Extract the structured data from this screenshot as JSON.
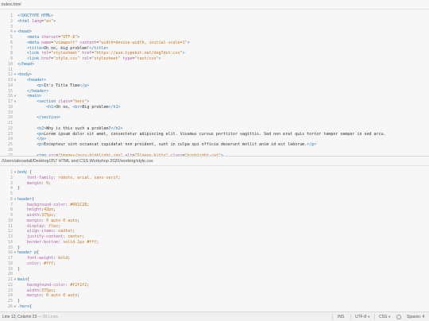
{
  "top_pane": {
    "title": "index.html",
    "lines": [
      {
        "n": "1",
        "fold": "",
        "spans": [
          {
            "c": "tag",
            "t": "<!DOCTYPE HTML>"
          }
        ]
      },
      {
        "n": "2",
        "fold": "",
        "spans": [
          {
            "c": "tag",
            "t": "<html "
          },
          {
            "c": "attr",
            "t": "lang"
          },
          {
            "c": "punc",
            "t": "="
          },
          {
            "c": "str",
            "t": "\"en\""
          },
          {
            "c": "tag",
            "t": ">"
          }
        ]
      },
      {
        "n": "3",
        "fold": "",
        "spans": []
      },
      {
        "n": "4",
        "fold": "▼",
        "spans": [
          {
            "c": "tag",
            "t": "<head>"
          }
        ]
      },
      {
        "n": "5",
        "fold": "",
        "spans": [
          {
            "c": "txt",
            "t": "    "
          },
          {
            "c": "tag",
            "t": "<meta "
          },
          {
            "c": "attr",
            "t": "charset"
          },
          {
            "c": "punc",
            "t": "="
          },
          {
            "c": "str",
            "t": "\"UTF-8\""
          },
          {
            "c": "tag",
            "t": ">"
          }
        ]
      },
      {
        "n": "6",
        "fold": "",
        "spans": [
          {
            "c": "txt",
            "t": "    "
          },
          {
            "c": "tag",
            "t": "<meta "
          },
          {
            "c": "attr",
            "t": "name"
          },
          {
            "c": "punc",
            "t": "="
          },
          {
            "c": "str",
            "t": "\"viewport\" "
          },
          {
            "c": "attr",
            "t": "content"
          },
          {
            "c": "punc",
            "t": "="
          },
          {
            "c": "str",
            "t": "\"width=device-width, initial-scale=1\""
          },
          {
            "c": "tag",
            "t": ">"
          }
        ]
      },
      {
        "n": "7",
        "fold": "",
        "spans": [
          {
            "c": "txt",
            "t": "    "
          },
          {
            "c": "tag",
            "t": "<title>"
          },
          {
            "c": "txt",
            "t": "Oh no, big problem!"
          },
          {
            "c": "tag",
            "t": "</title>"
          }
        ]
      },
      {
        "n": "8",
        "fold": "",
        "spans": [
          {
            "c": "txt",
            "t": "    "
          },
          {
            "c": "tag",
            "t": "<link "
          },
          {
            "c": "attr",
            "t": "rel"
          },
          {
            "c": "punc",
            "t": "="
          },
          {
            "c": "str",
            "t": "\"stylesheet\" "
          },
          {
            "c": "attr",
            "t": "href"
          },
          {
            "c": "punc",
            "t": "="
          },
          {
            "c": "str",
            "t": "\"https://use.typekit.net/dog7dxt.css\""
          },
          {
            "c": "tag",
            "t": ">"
          }
        ]
      },
      {
        "n": "9",
        "fold": "",
        "spans": [
          {
            "c": "txt",
            "t": "    "
          },
          {
            "c": "tag",
            "t": "<link "
          },
          {
            "c": "attr",
            "t": "href"
          },
          {
            "c": "punc",
            "t": "="
          },
          {
            "c": "str",
            "t": "\"style.css\" "
          },
          {
            "c": "attr",
            "t": "rel"
          },
          {
            "c": "punc",
            "t": "="
          },
          {
            "c": "str",
            "t": "\"stylesheet\" "
          },
          {
            "c": "attr",
            "t": "type"
          },
          {
            "c": "punc",
            "t": "="
          },
          {
            "c": "str",
            "t": "\"text/css\""
          },
          {
            "c": "tag",
            "t": ">"
          }
        ]
      },
      {
        "n": "10",
        "fold": "",
        "spans": [
          {
            "c": "tag",
            "t": "</head>"
          }
        ]
      },
      {
        "n": "11",
        "fold": "",
        "spans": []
      },
      {
        "n": "12",
        "fold": "▼",
        "spans": [
          {
            "c": "tag",
            "t": "<body>"
          }
        ]
      },
      {
        "n": "13",
        "fold": "▼",
        "spans": [
          {
            "c": "txt",
            "t": "    "
          },
          {
            "c": "tag",
            "t": "<header>"
          }
        ]
      },
      {
        "n": "14",
        "fold": "",
        "spans": [
          {
            "c": "txt",
            "t": "        "
          },
          {
            "c": "tag",
            "t": "<p>"
          },
          {
            "c": "txt",
            "t": "It's Title Time"
          },
          {
            "c": "tag",
            "t": "</p>"
          }
        ]
      },
      {
        "n": "15",
        "fold": "",
        "spans": [
          {
            "c": "txt",
            "t": "    "
          },
          {
            "c": "tag",
            "t": "</header>"
          }
        ]
      },
      {
        "n": "16",
        "fold": "▼",
        "spans": [
          {
            "c": "txt",
            "t": "    "
          },
          {
            "c": "tag",
            "t": "<main>"
          }
        ]
      },
      {
        "n": "17",
        "fold": "▼",
        "spans": [
          {
            "c": "txt",
            "t": "        "
          },
          {
            "c": "tag",
            "t": "<section "
          },
          {
            "c": "attr",
            "t": "class"
          },
          {
            "c": "punc",
            "t": "="
          },
          {
            "c": "str",
            "t": "\"hero\""
          },
          {
            "c": "tag",
            "t": ">"
          }
        ]
      },
      {
        "n": "18",
        "fold": "",
        "spans": [
          {
            "c": "txt",
            "t": "            "
          },
          {
            "c": "tag",
            "t": "<h1>"
          },
          {
            "c": "txt",
            "t": "Oh no, "
          },
          {
            "c": "tag",
            "t": "<br>"
          },
          {
            "c": "txt",
            "t": "Big problem"
          },
          {
            "c": "tag",
            "t": "</h1>"
          }
        ]
      },
      {
        "n": "19",
        "fold": "",
        "spans": []
      },
      {
        "n": "20",
        "fold": "",
        "spans": [
          {
            "c": "txt",
            "t": "        "
          },
          {
            "c": "tag",
            "t": "</section>"
          }
        ]
      },
      {
        "n": "21",
        "fold": "",
        "spans": []
      },
      {
        "n": "22",
        "fold": "",
        "spans": [
          {
            "c": "txt",
            "t": "        "
          },
          {
            "c": "tag",
            "t": "<h2>"
          },
          {
            "c": "txt",
            "t": "Why is this such a problem?"
          },
          {
            "c": "tag",
            "t": "</h2>"
          }
        ]
      },
      {
        "n": "23",
        "fold": "",
        "spans": [
          {
            "c": "txt",
            "t": "        "
          },
          {
            "c": "tag",
            "t": "<p>"
          },
          {
            "c": "txt",
            "t": "Lorem ipsum dolor sit amet, consectetur adipiscing elit. Vivamus cursus porttitor sagittis. Sed non erat quis tortor tempor semper in sed arcu."
          }
        ]
      },
      {
        "n": "24",
        "fold": "",
        "spans": [
          {
            "c": "txt",
            "t": "        "
          },
          {
            "c": "tag",
            "t": "</p>"
          }
        ]
      },
      {
        "n": "25",
        "fold": "",
        "spans": [
          {
            "c": "txt",
            "t": "        "
          },
          {
            "c": "tag",
            "t": "<p>"
          },
          {
            "c": "txt",
            "t": "Excepteur sint occaecat cupidatat non proident, sunt in culpa qui officia deserunt mollit anim id est laborum."
          },
          {
            "c": "tag",
            "t": "</p>"
          }
        ]
      },
      {
        "n": "26",
        "fold": "",
        "spans": []
      },
      {
        "n": "27",
        "fold": "",
        "spans": [
          {
            "c": "txt",
            "t": "        "
          },
          {
            "c": "tag",
            "t": "<img "
          },
          {
            "c": "attr",
            "t": "src"
          },
          {
            "c": "punc",
            "t": "="
          },
          {
            "c": "str",
            "t": "\"images/suzy-highlight.jpg\" "
          },
          {
            "c": "attr",
            "t": "alt"
          },
          {
            "c": "punc",
            "t": "="
          },
          {
            "c": "str",
            "t": "\"Sleepy kitty\" "
          },
          {
            "c": "attr",
            "t": "class"
          },
          {
            "c": "punc",
            "t": "="
          },
          {
            "c": "str",
            "t": "\"highlight-cat\""
          },
          {
            "c": "tag",
            "t": ">"
          }
        ]
      }
    ]
  },
  "bottom_pane": {
    "title": "/Users/alexadall/Desktop/257 HTML and CSS Workshop 2020/working/style.css",
    "lines": [
      {
        "n": "1",
        "fold": "▼",
        "spans": [
          {
            "c": "sel",
            "t": "body "
          },
          {
            "c": "punc",
            "t": "{"
          }
        ]
      },
      {
        "n": "2",
        "fold": "",
        "spans": [
          {
            "c": "txt",
            "t": "    "
          },
          {
            "c": "prop",
            "t": "font-family"
          },
          {
            "c": "punc",
            "t": ": "
          },
          {
            "c": "val",
            "t": "roboto, arial, sans-serif"
          },
          {
            "c": "punc",
            "t": ";"
          }
        ]
      },
      {
        "n": "3",
        "fold": "",
        "spans": [
          {
            "c": "txt",
            "t": "    "
          },
          {
            "c": "prop",
            "t": "margin"
          },
          {
            "c": "punc",
            "t": ": "
          },
          {
            "c": "val",
            "t": "0"
          },
          {
            "c": "punc",
            "t": ";"
          }
        ]
      },
      {
        "n": "4",
        "fold": "",
        "spans": [
          {
            "c": "punc",
            "t": "}"
          }
        ]
      },
      {
        "n": "5",
        "fold": "",
        "spans": []
      },
      {
        "n": "6",
        "fold": "▼",
        "spans": [
          {
            "c": "sel",
            "t": "header"
          },
          {
            "c": "punc",
            "t": "{"
          }
        ]
      },
      {
        "n": "7",
        "fold": "",
        "spans": [
          {
            "c": "txt",
            "t": "    "
          },
          {
            "c": "prop",
            "t": "background-color"
          },
          {
            "c": "punc",
            "t": ": "
          },
          {
            "c": "val",
            "t": "#001C28"
          },
          {
            "c": "punc",
            "t": ";"
          }
        ]
      },
      {
        "n": "8",
        "fold": "",
        "spans": [
          {
            "c": "txt",
            "t": "    "
          },
          {
            "c": "prop",
            "t": "height"
          },
          {
            "c": "punc",
            "t": ":"
          },
          {
            "c": "val",
            "t": "42px"
          },
          {
            "c": "punc",
            "t": ";"
          }
        ]
      },
      {
        "n": "9",
        "fold": "",
        "spans": [
          {
            "c": "txt",
            "t": "    "
          },
          {
            "c": "prop",
            "t": "width"
          },
          {
            "c": "punc",
            "t": ":"
          },
          {
            "c": "val",
            "t": "375px"
          },
          {
            "c": "punc",
            "t": ";"
          }
        ]
      },
      {
        "n": "10",
        "fold": "",
        "spans": [
          {
            "c": "txt",
            "t": "    "
          },
          {
            "c": "prop",
            "t": "margin"
          },
          {
            "c": "punc",
            "t": ": "
          },
          {
            "c": "val",
            "t": "0 auto 0 auto"
          },
          {
            "c": "punc",
            "t": ";"
          }
        ]
      },
      {
        "n": "11",
        "fold": "",
        "spans": [
          {
            "c": "txt",
            "t": "    "
          },
          {
            "c": "prop",
            "t": "display"
          },
          {
            "c": "punc",
            "t": ": "
          },
          {
            "c": "val",
            "t": "flex"
          },
          {
            "c": "punc",
            "t": ";"
          }
        ]
      },
      {
        "n": "12",
        "fold": "",
        "spans": [
          {
            "c": "txt",
            "t": "    "
          },
          {
            "c": "prop",
            "t": "align-items"
          },
          {
            "c": "punc",
            "t": ": "
          },
          {
            "c": "val",
            "t": "center"
          },
          {
            "c": "punc",
            "t": ";"
          }
        ]
      },
      {
        "n": "13",
        "fold": "",
        "spans": [
          {
            "c": "txt",
            "t": "    "
          },
          {
            "c": "prop",
            "t": "justify-content"
          },
          {
            "c": "punc",
            "t": ": "
          },
          {
            "c": "val",
            "t": "center"
          },
          {
            "c": "punc",
            "t": ";"
          }
        ]
      },
      {
        "n": "14",
        "fold": "",
        "spans": [
          {
            "c": "txt",
            "t": "    "
          },
          {
            "c": "prop",
            "t": "border-bottom"
          },
          {
            "c": "punc",
            "t": ": "
          },
          {
            "c": "val",
            "t": "solid 1px #fff"
          },
          {
            "c": "punc",
            "t": ";"
          }
        ]
      },
      {
        "n": "15",
        "fold": "",
        "spans": [
          {
            "c": "punc",
            "t": "}"
          }
        ]
      },
      {
        "n": "16",
        "fold": "▼",
        "spans": [
          {
            "c": "sel",
            "t": "header p"
          },
          {
            "c": "punc",
            "t": "{"
          }
        ]
      },
      {
        "n": "17",
        "fold": "",
        "spans": [
          {
            "c": "txt",
            "t": "    "
          },
          {
            "c": "prop",
            "t": "font-weight"
          },
          {
            "c": "punc",
            "t": ": "
          },
          {
            "c": "val",
            "t": "bold"
          },
          {
            "c": "punc",
            "t": ";"
          }
        ]
      },
      {
        "n": "18",
        "fold": "",
        "spans": [
          {
            "c": "txt",
            "t": "    "
          },
          {
            "c": "prop",
            "t": "color"
          },
          {
            "c": "punc",
            "t": ": "
          },
          {
            "c": "val",
            "t": "#fff"
          },
          {
            "c": "punc",
            "t": ";"
          }
        ]
      },
      {
        "n": "19",
        "fold": "",
        "spans": [
          {
            "c": "punc",
            "t": "}"
          }
        ]
      },
      {
        "n": "20",
        "fold": "",
        "spans": []
      },
      {
        "n": "21",
        "fold": "▼",
        "spans": [
          {
            "c": "sel",
            "t": "main"
          },
          {
            "c": "punc",
            "t": "{"
          }
        ]
      },
      {
        "n": "22",
        "fold": "",
        "spans": [
          {
            "c": "txt",
            "t": "    "
          },
          {
            "c": "prop",
            "t": "background-color"
          },
          {
            "c": "punc",
            "t": ": "
          },
          {
            "c": "val",
            "t": "#f2f2f2"
          },
          {
            "c": "punc",
            "t": ";"
          }
        ]
      },
      {
        "n": "23",
        "fold": "",
        "spans": [
          {
            "c": "txt",
            "t": "    "
          },
          {
            "c": "prop",
            "t": "width"
          },
          {
            "c": "punc",
            "t": ":"
          },
          {
            "c": "val",
            "t": "375px"
          },
          {
            "c": "punc",
            "t": ";"
          }
        ]
      },
      {
        "n": "24",
        "fold": "",
        "spans": [
          {
            "c": "txt",
            "t": "    "
          },
          {
            "c": "prop",
            "t": "margin"
          },
          {
            "c": "punc",
            "t": ": "
          },
          {
            "c": "val",
            "t": "0 auto 0 auto"
          },
          {
            "c": "punc",
            "t": ";"
          }
        ]
      },
      {
        "n": "25",
        "fold": "",
        "spans": [
          {
            "c": "punc",
            "t": "}"
          }
        ]
      },
      {
        "n": "26",
        "fold": "▼",
        "spans": [
          {
            "c": "sel",
            "t": ".hero"
          },
          {
            "c": "punc",
            "t": "{"
          }
        ]
      }
    ]
  },
  "status_bar": {
    "position": "Line 12, Column 23",
    "selection": "— 83 Lines",
    "mode": "INS",
    "encoding": "UTF-8",
    "language": "CSS",
    "spaces": "Spaces: 4"
  }
}
